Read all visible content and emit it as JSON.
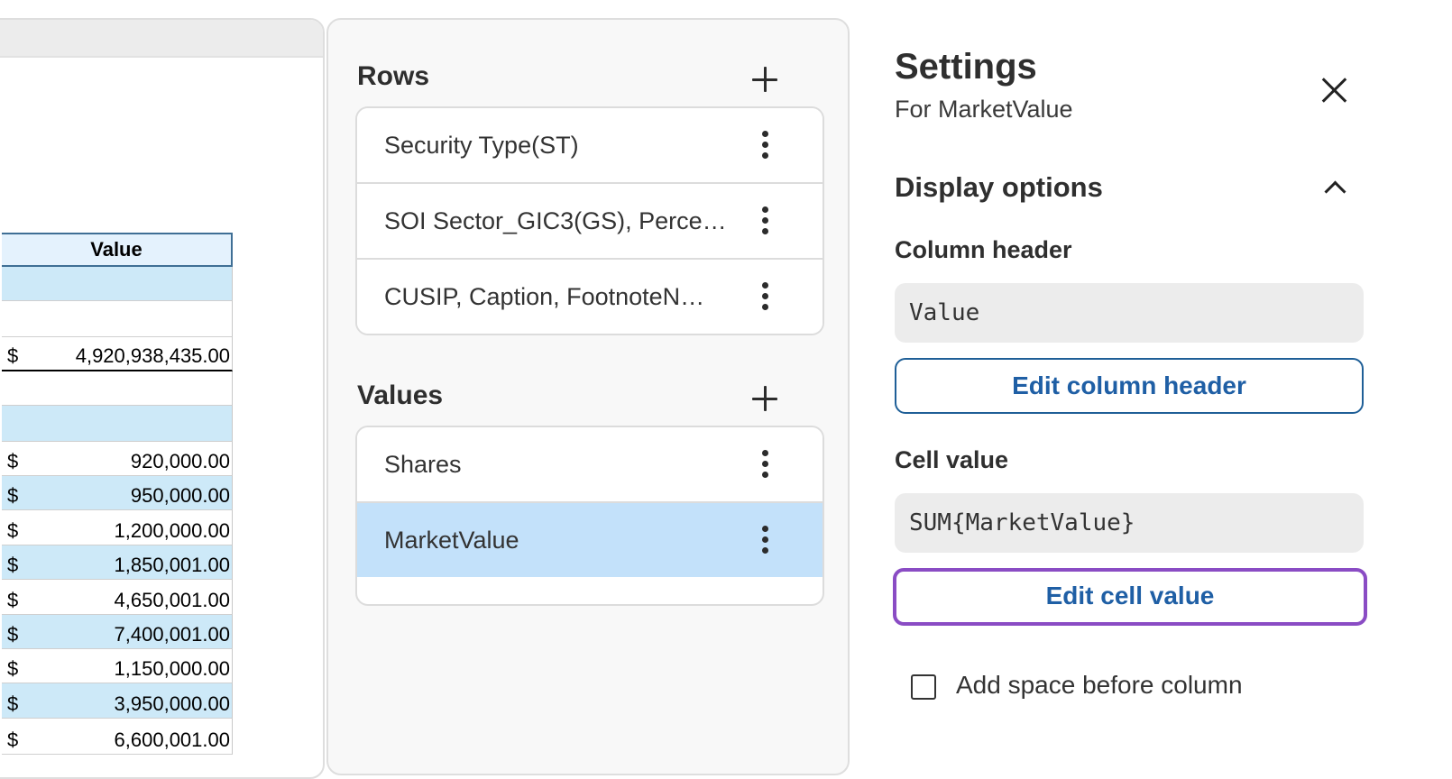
{
  "preview": {
    "column_header": "Value",
    "rows": [
      {
        "style": "blue",
        "currency": "",
        "amount": ""
      },
      {
        "style": "white",
        "currency": "",
        "amount": ""
      },
      {
        "style": "white",
        "currency": "$",
        "amount": "4,920,938,435.00",
        "total": true
      },
      {
        "style": "white",
        "currency": "",
        "amount": ""
      },
      {
        "style": "blue",
        "currency": "",
        "amount": ""
      },
      {
        "style": "white",
        "currency": "$",
        "amount": "920,000.00"
      },
      {
        "style": "blue",
        "currency": "$",
        "amount": "950,000.00"
      },
      {
        "style": "white",
        "currency": "$",
        "amount": "1,200,000.00"
      },
      {
        "style": "blue",
        "currency": "$",
        "amount": "1,850,001.00"
      },
      {
        "style": "white",
        "currency": "$",
        "amount": "4,650,001.00"
      },
      {
        "style": "blue",
        "currency": "$",
        "amount": "7,400,001.00"
      },
      {
        "style": "white",
        "currency": "$",
        "amount": "1,150,000.00"
      },
      {
        "style": "blue",
        "currency": "$",
        "amount": "3,950,000.00"
      },
      {
        "style": "white",
        "currency": "$",
        "amount": "6,600,001.00"
      }
    ]
  },
  "fields": {
    "rows_title": "Rows",
    "rows": [
      "Security Type(ST)",
      "SOI Sector_GIC3(GS), Perce…",
      "CUSIP, Caption, FootnoteN…"
    ],
    "values_title": "Values",
    "values": [
      "Shares",
      "MarketValue"
    ],
    "selected_value": "MarketValue"
  },
  "settings": {
    "title": "Settings",
    "subtitle": "For MarketValue",
    "display_options_title": "Display options",
    "column_header_label": "Column header",
    "column_header_value": "Value",
    "edit_column_header_label": "Edit column header",
    "cell_value_label": "Cell value",
    "cell_value": "SUM{MarketValue}",
    "edit_cell_value_label": "Edit cell value",
    "add_space_label": "Add space before column",
    "add_space_checked": false
  },
  "colors": {
    "row_highlight": "#cde9f8",
    "selected_field": "#c3e1fa",
    "button_text": "#1f5fa5",
    "focus_ring": "#8a4cc4"
  }
}
